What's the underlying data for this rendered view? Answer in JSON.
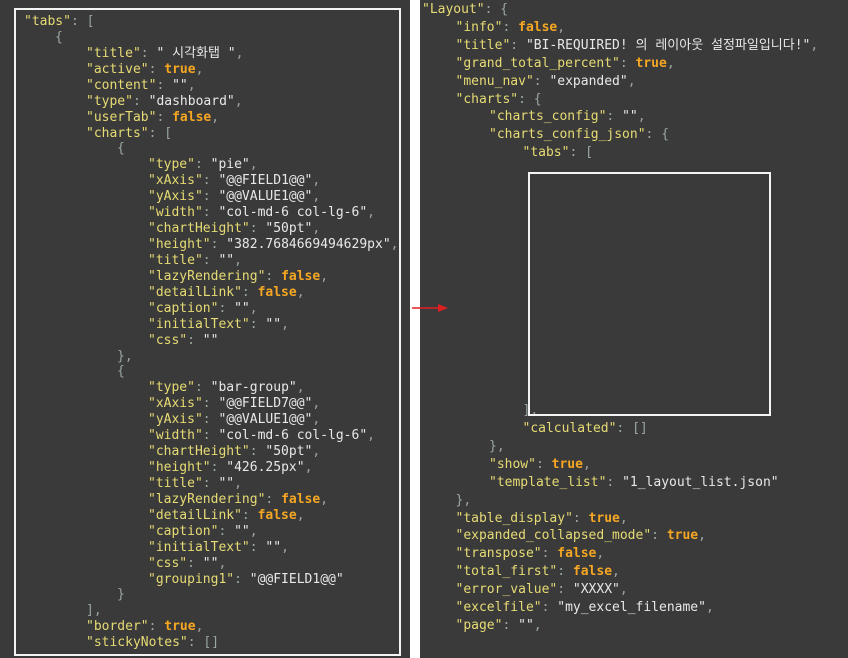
{
  "left_lines": [
    {
      "i": 0,
      "t": [
        [
          "k",
          "\"tabs\""
        ],
        [
          "p",
          ": ["
        ]
      ]
    },
    {
      "i": 1,
      "t": [
        [
          "p",
          "{"
        ]
      ]
    },
    {
      "i": 2,
      "t": [
        [
          "k",
          "\"title\""
        ],
        [
          "p",
          ": "
        ],
        [
          "s",
          "\" 시각화탭 \""
        ],
        [
          "p",
          ","
        ]
      ]
    },
    {
      "i": 2,
      "t": [
        [
          "k",
          "\"active\""
        ],
        [
          "p",
          ": "
        ],
        [
          "b",
          "true"
        ],
        [
          "p",
          ","
        ]
      ]
    },
    {
      "i": 2,
      "t": [
        [
          "k",
          "\"content\""
        ],
        [
          "p",
          ": "
        ],
        [
          "s",
          "\"\""
        ],
        [
          "p",
          ","
        ]
      ]
    },
    {
      "i": 2,
      "t": [
        [
          "k",
          "\"type\""
        ],
        [
          "p",
          ": "
        ],
        [
          "s",
          "\"dashboard\""
        ],
        [
          "p",
          ","
        ]
      ]
    },
    {
      "i": 2,
      "t": [
        [
          "k",
          "\"userTab\""
        ],
        [
          "p",
          ": "
        ],
        [
          "b",
          "false"
        ],
        [
          "p",
          ","
        ]
      ]
    },
    {
      "i": 2,
      "t": [
        [
          "k",
          "\"charts\""
        ],
        [
          "p",
          ": ["
        ]
      ]
    },
    {
      "i": 3,
      "t": [
        [
          "p",
          "{"
        ]
      ]
    },
    {
      "i": 4,
      "t": [
        [
          "k",
          "\"type\""
        ],
        [
          "p",
          ": "
        ],
        [
          "s",
          "\"pie\""
        ],
        [
          "p",
          ","
        ]
      ]
    },
    {
      "i": 4,
      "t": [
        [
          "k",
          "\"xAxis\""
        ],
        [
          "p",
          ": "
        ],
        [
          "s",
          "\"@@FIELD1@@\""
        ],
        [
          "p",
          ","
        ]
      ]
    },
    {
      "i": 4,
      "t": [
        [
          "k",
          "\"yAxis\""
        ],
        [
          "p",
          ": "
        ],
        [
          "s",
          "\"@@VALUE1@@\""
        ],
        [
          "p",
          ","
        ]
      ]
    },
    {
      "i": 4,
      "t": [
        [
          "k",
          "\"width\""
        ],
        [
          "p",
          ": "
        ],
        [
          "s",
          "\"col-md-6 col-lg-6\""
        ],
        [
          "p",
          ","
        ]
      ]
    },
    {
      "i": 4,
      "t": [
        [
          "k",
          "\"chartHeight\""
        ],
        [
          "p",
          ": "
        ],
        [
          "s",
          "\"50pt\""
        ],
        [
          "p",
          ","
        ]
      ]
    },
    {
      "i": 4,
      "t": [
        [
          "k",
          "\"height\""
        ],
        [
          "p",
          ": "
        ],
        [
          "s",
          "\"382.7684669494629px\""
        ],
        [
          "p",
          ","
        ]
      ]
    },
    {
      "i": 4,
      "t": [
        [
          "k",
          "\"title\""
        ],
        [
          "p",
          ": "
        ],
        [
          "s",
          "\"\""
        ],
        [
          "p",
          ","
        ]
      ]
    },
    {
      "i": 4,
      "t": [
        [
          "k",
          "\"lazyRendering\""
        ],
        [
          "p",
          ": "
        ],
        [
          "b",
          "false"
        ],
        [
          "p",
          ","
        ]
      ]
    },
    {
      "i": 4,
      "t": [
        [
          "k",
          "\"detailLink\""
        ],
        [
          "p",
          ": "
        ],
        [
          "b",
          "false"
        ],
        [
          "p",
          ","
        ]
      ]
    },
    {
      "i": 4,
      "t": [
        [
          "k",
          "\"caption\""
        ],
        [
          "p",
          ": "
        ],
        [
          "s",
          "\"\""
        ],
        [
          "p",
          ","
        ]
      ]
    },
    {
      "i": 4,
      "t": [
        [
          "k",
          "\"initialText\""
        ],
        [
          "p",
          ": "
        ],
        [
          "s",
          "\"\""
        ],
        [
          "p",
          ","
        ]
      ]
    },
    {
      "i": 4,
      "t": [
        [
          "k",
          "\"css\""
        ],
        [
          "p",
          ": "
        ],
        [
          "s",
          "\"\""
        ]
      ]
    },
    {
      "i": 3,
      "t": [
        [
          "p",
          "},"
        ]
      ]
    },
    {
      "i": 3,
      "t": [
        [
          "p",
          "{"
        ]
      ]
    },
    {
      "i": 4,
      "t": [
        [
          "k",
          "\"type\""
        ],
        [
          "p",
          ": "
        ],
        [
          "s",
          "\"bar-group\""
        ],
        [
          "p",
          ","
        ]
      ]
    },
    {
      "i": 4,
      "t": [
        [
          "k",
          "\"xAxis\""
        ],
        [
          "p",
          ": "
        ],
        [
          "s",
          "\"@@FIELD7@@\""
        ],
        [
          "p",
          ","
        ]
      ]
    },
    {
      "i": 4,
      "t": [
        [
          "k",
          "\"yAxis\""
        ],
        [
          "p",
          ": "
        ],
        [
          "s",
          "\"@@VALUE1@@\""
        ],
        [
          "p",
          ","
        ]
      ]
    },
    {
      "i": 4,
      "t": [
        [
          "k",
          "\"width\""
        ],
        [
          "p",
          ": "
        ],
        [
          "s",
          "\"col-md-6 col-lg-6\""
        ],
        [
          "p",
          ","
        ]
      ]
    },
    {
      "i": 4,
      "t": [
        [
          "k",
          "\"chartHeight\""
        ],
        [
          "p",
          ": "
        ],
        [
          "s",
          "\"50pt\""
        ],
        [
          "p",
          ","
        ]
      ]
    },
    {
      "i": 4,
      "t": [
        [
          "k",
          "\"height\""
        ],
        [
          "p",
          ": "
        ],
        [
          "s",
          "\"426.25px\""
        ],
        [
          "p",
          ","
        ]
      ]
    },
    {
      "i": 4,
      "t": [
        [
          "k",
          "\"title\""
        ],
        [
          "p",
          ": "
        ],
        [
          "s",
          "\"\""
        ],
        [
          "p",
          ","
        ]
      ]
    },
    {
      "i": 4,
      "t": [
        [
          "k",
          "\"lazyRendering\""
        ],
        [
          "p",
          ": "
        ],
        [
          "b",
          "false"
        ],
        [
          "p",
          ","
        ]
      ]
    },
    {
      "i": 4,
      "t": [
        [
          "k",
          "\"detailLink\""
        ],
        [
          "p",
          ": "
        ],
        [
          "b",
          "false"
        ],
        [
          "p",
          ","
        ]
      ]
    },
    {
      "i": 4,
      "t": [
        [
          "k",
          "\"caption\""
        ],
        [
          "p",
          ": "
        ],
        [
          "s",
          "\"\""
        ],
        [
          "p",
          ","
        ]
      ]
    },
    {
      "i": 4,
      "t": [
        [
          "k",
          "\"initialText\""
        ],
        [
          "p",
          ": "
        ],
        [
          "s",
          "\"\""
        ],
        [
          "p",
          ","
        ]
      ]
    },
    {
      "i": 4,
      "t": [
        [
          "k",
          "\"css\""
        ],
        [
          "p",
          ": "
        ],
        [
          "s",
          "\"\""
        ],
        [
          "p",
          ","
        ]
      ]
    },
    {
      "i": 4,
      "t": [
        [
          "k",
          "\"grouping1\""
        ],
        [
          "p",
          ": "
        ],
        [
          "s",
          "\"@@FIELD1@@\""
        ]
      ]
    },
    {
      "i": 3,
      "t": [
        [
          "p",
          "}"
        ]
      ]
    },
    {
      "i": 2,
      "t": [
        [
          "p",
          "],"
        ]
      ]
    },
    {
      "i": 2,
      "t": [
        [
          "k",
          "\"border\""
        ],
        [
          "p",
          ": "
        ],
        [
          "b",
          "true"
        ],
        [
          "p",
          ","
        ]
      ]
    },
    {
      "i": 2,
      "t": [
        [
          "k",
          "\"stickyNotes\""
        ],
        [
          "p",
          ": []"
        ]
      ]
    }
  ],
  "right_lines": [
    {
      "i": 0,
      "t": [
        [
          "k",
          "\"Layout\""
        ],
        [
          "p",
          ": {"
        ]
      ]
    },
    {
      "i": 1,
      "t": [
        [
          "k",
          "\"info\""
        ],
        [
          "p",
          ": "
        ],
        [
          "b",
          "false"
        ],
        [
          "p",
          ","
        ]
      ]
    },
    {
      "i": 1,
      "t": [
        [
          "k",
          "\"title\""
        ],
        [
          "p",
          ": "
        ],
        [
          "s",
          "\"BI-REQUIRED! 의 레이아웃 설정파일입니다!\""
        ],
        [
          "p",
          ","
        ]
      ]
    },
    {
      "i": 1,
      "t": [
        [
          "k",
          "\"grand_total_percent\""
        ],
        [
          "p",
          ": "
        ],
        [
          "b",
          "true"
        ],
        [
          "p",
          ","
        ]
      ]
    },
    {
      "i": 1,
      "t": [
        [
          "k",
          "\"menu_nav\""
        ],
        [
          "p",
          ": "
        ],
        [
          "s",
          "\"expanded\""
        ],
        [
          "p",
          ","
        ]
      ]
    },
    {
      "i": 1,
      "t": [
        [
          "k",
          "\"charts\""
        ],
        [
          "p",
          ": {"
        ]
      ]
    },
    {
      "i": 2,
      "t": [
        [
          "k",
          "\"charts_config\""
        ],
        [
          "p",
          ": "
        ],
        [
          "s",
          "\"\""
        ],
        [
          "p",
          ","
        ]
      ]
    },
    {
      "i": 2,
      "t": [
        [
          "k",
          "\"charts_config_json\""
        ],
        [
          "p",
          ": {"
        ]
      ]
    },
    {
      "i": 3,
      "t": [
        [
          "k",
          "\"tabs\""
        ],
        [
          "p",
          ": ["
        ]
      ]
    },
    {
      "i": 3,
      "gap": 16,
      "t": [
        [
          "p",
          "],"
        ]
      ]
    },
    {
      "i": 3,
      "t": [
        [
          "k",
          "\"calculated\""
        ],
        [
          "p",
          ": []"
        ]
      ]
    },
    {
      "i": 2,
      "t": [
        [
          "p",
          "},"
        ]
      ]
    },
    {
      "i": 2,
      "t": [
        [
          "k",
          "\"show\""
        ],
        [
          "p",
          ": "
        ],
        [
          "b",
          "true"
        ],
        [
          "p",
          ","
        ]
      ]
    },
    {
      "i": 2,
      "t": [
        [
          "k",
          "\"template_list\""
        ],
        [
          "p",
          ": "
        ],
        [
          "s",
          "\"1_layout_list.json\""
        ]
      ]
    },
    {
      "i": 1,
      "t": [
        [
          "p",
          "},"
        ]
      ]
    },
    {
      "i": 1,
      "t": [
        [
          "k",
          "\"table_display\""
        ],
        [
          "p",
          ": "
        ],
        [
          "b",
          "true"
        ],
        [
          "p",
          ","
        ]
      ]
    },
    {
      "i": 1,
      "t": [
        [
          "k",
          "\"expanded_collapsed_mode\""
        ],
        [
          "p",
          ": "
        ],
        [
          "b",
          "true"
        ],
        [
          "p",
          ","
        ]
      ]
    },
    {
      "i": 1,
      "t": [
        [
          "k",
          "\"transpose\""
        ],
        [
          "p",
          ": "
        ],
        [
          "b",
          "false"
        ],
        [
          "p",
          ","
        ]
      ]
    },
    {
      "i": 1,
      "t": [
        [
          "k",
          "\"total_first\""
        ],
        [
          "p",
          ": "
        ],
        [
          "b",
          "false"
        ],
        [
          "p",
          ","
        ]
      ]
    },
    {
      "i": 1,
      "t": [
        [
          "k",
          "\"error_value\""
        ],
        [
          "p",
          ": "
        ],
        [
          "s",
          "\"XXXX\""
        ],
        [
          "p",
          ","
        ]
      ]
    },
    {
      "i": 1,
      "t": [
        [
          "k",
          "\"excelfile\""
        ],
        [
          "p",
          ": "
        ],
        [
          "s",
          "\"my_excel_filename\""
        ],
        [
          "p",
          ","
        ]
      ]
    },
    {
      "i": 1,
      "t": [
        [
          "k",
          "\"page\""
        ],
        [
          "p",
          ": "
        ],
        [
          "s",
          "\"\""
        ],
        [
          "p",
          ","
        ]
      ]
    }
  ],
  "colors": {
    "background": "#3a3a3a",
    "key": "#e6db74",
    "string": "#e8e8e8",
    "boolean": "#f5a623",
    "punctuation": "#9aa7a0",
    "outline": "#f4f4f4",
    "arrow": "#e02020"
  }
}
